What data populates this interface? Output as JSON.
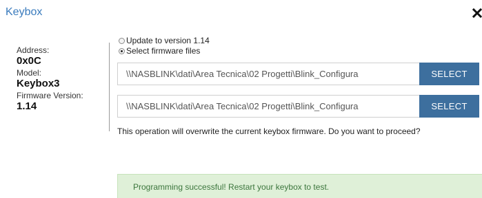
{
  "dialog": {
    "title": "Keybox"
  },
  "device": {
    "address_label": "Address:",
    "address_value": "0x0C",
    "model_label": "Model:",
    "model_value": "Keybox3",
    "firmware_label": "Firmware Version:",
    "firmware_value": "1.14"
  },
  "options": {
    "update_label": "Update to version 1.14",
    "update_checked": false,
    "select_files_label": "Select firmware files",
    "select_files_checked": true
  },
  "files": [
    {
      "path": "\\\\NASBLINK\\dati\\Area Tecnica\\02 Progetti\\Blink_Configura",
      "button_label": "SELECT"
    },
    {
      "path": "\\\\NASBLINK\\dati\\Area Tecnica\\02 Progetti\\Blink_Configura",
      "button_label": "SELECT"
    }
  ],
  "warning": "This operation will overwrite the current keybox firmware. Do you want to proceed?",
  "alert": {
    "message": "Programming successful! Restart your keybox to test.",
    "type": "success"
  },
  "icons": {
    "close": "close-icon"
  },
  "colors": {
    "title": "#3a7bbd",
    "button": "#3d6f9e",
    "alert_bg": "#dff0d8",
    "alert_text": "#3c763d"
  }
}
